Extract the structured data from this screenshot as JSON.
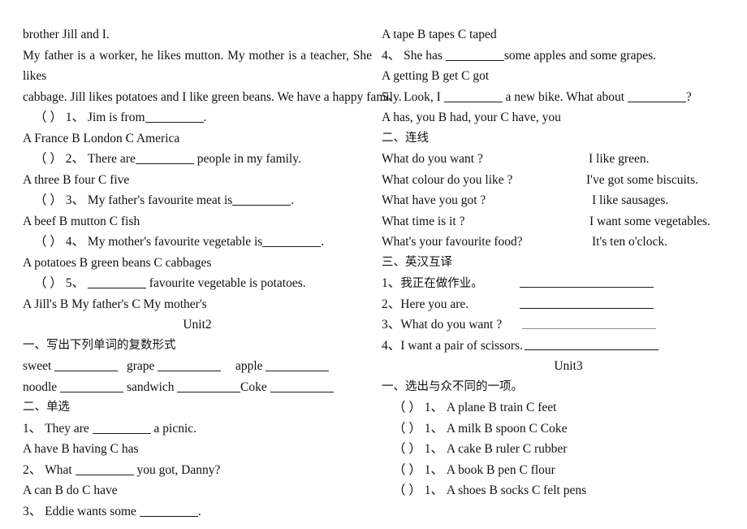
{
  "document": {
    "left_column": {
      "passage": {
        "line1": "brother Jill and I.",
        "line2": "My father is a worker, he likes mutton. My mother is a teacher, She likes",
        "line3": "cabbage. Jill likes potatoes and I like green beans. We have a happy family."
      },
      "reading_questions": [
        {
          "paren": "（      ）",
          "number": "1、",
          "stem_before": "Jim is from",
          "stem_after": ".",
          "options": "A France    B London    C America"
        },
        {
          "paren": "（      ）",
          "number": "2、",
          "stem_before": "There are",
          "stem_after": "people in my family.",
          "options": "A three    B four    C five"
        },
        {
          "paren": "（      ）",
          "number": "3、",
          "stem_before": "My father's favourite meat is",
          "stem_after": ".",
          "options": "A beef    B mutton    C fish"
        },
        {
          "paren": "（      ）",
          "number": "4、",
          "stem_before": "My mother's favourite vegetable is",
          "stem_after": ".",
          "options": "A potatoes    B green beans    C cabbages"
        },
        {
          "paren": "（      ）",
          "number": "5、",
          "stem_before": "",
          "stem_after": "favourite vegetable is potatoes.",
          "options": "A Jill's    B My father's    C My mother's"
        }
      ],
      "unit2_title": "Unit2",
      "unit2_section1_heading": "一、写出下列单词的复数形式",
      "plural_words": [
        [
          "sweet",
          "grape",
          "apple"
        ],
        [
          "noodle",
          "sandwich",
          "Coke"
        ]
      ],
      "unit2_section2_heading": "二、单选",
      "unit2_choice_questions": [
        {
          "number": "1、",
          "stem_before": "They are",
          "stem_after": "a picnic.",
          "options": "A have    B having    C has"
        },
        {
          "number": "2、",
          "stem_before": "What",
          "stem_after": "you got, Danny?",
          "options": "A can    B do    C have"
        },
        {
          "number": "3、",
          "stem_before": "Eddie wants some",
          "stem_after": ".",
          "options": ""
        }
      ]
    },
    "right_column": {
      "continued_options_top": "A tape    B tapes    C taped",
      "unit2_choice_questions_cont": [
        {
          "number": "4、",
          "stem_before": "She has",
          "stem_after": "some apples and some grapes.",
          "options": "A getting    B get    C got"
        },
        {
          "number": "5、",
          "stem_before": "Look, I",
          "stem_mid": "a new bike. What about",
          "stem_after": "?",
          "options": "A has, you    B had, your    C have, you"
        }
      ],
      "matching_heading": "二、连线",
      "matching_pairs": [
        {
          "prompt": "What do you want ?",
          "answer": "I like green."
        },
        {
          "prompt": "What colour do you like ?",
          "answer": "I've got some biscuits."
        },
        {
          "prompt": "What have you got ?",
          "answer": "I like sausages."
        },
        {
          "prompt": "What time is it ?",
          "answer": "I want some vegetables."
        },
        {
          "prompt": "What's your favourite food?",
          "answer": "It's ten o'clock."
        }
      ],
      "translation_heading": "三、英汉互译",
      "translation_items": [
        {
          "number": "1、",
          "text": "我正在做作业。"
        },
        {
          "number": "2、",
          "text": "Here you are."
        },
        {
          "number": "3、",
          "text": "What do you want ?"
        },
        {
          "number": "4、",
          "text": "I want a pair of scissors."
        }
      ],
      "unit3_title": "Unit3",
      "unit3_section1_heading": "一、选出与众不同的一项。",
      "odd_one_out": [
        {
          "paren": "（      ）",
          "number": "1、",
          "options": "A plane    B train    C feet"
        },
        {
          "paren": "（      ）",
          "number": "1、",
          "options": "A milk    B spoon    C Coke"
        },
        {
          "paren": "（      ）",
          "number": "1、",
          "options": "A cake    B ruler    C rubber"
        },
        {
          "paren": "（      ）",
          "number": "1、",
          "options": "A book    B pen    C flour"
        },
        {
          "paren": "（      ）",
          "number": "1、",
          "options": "A shoes    B socks    C felt pens"
        }
      ]
    }
  }
}
